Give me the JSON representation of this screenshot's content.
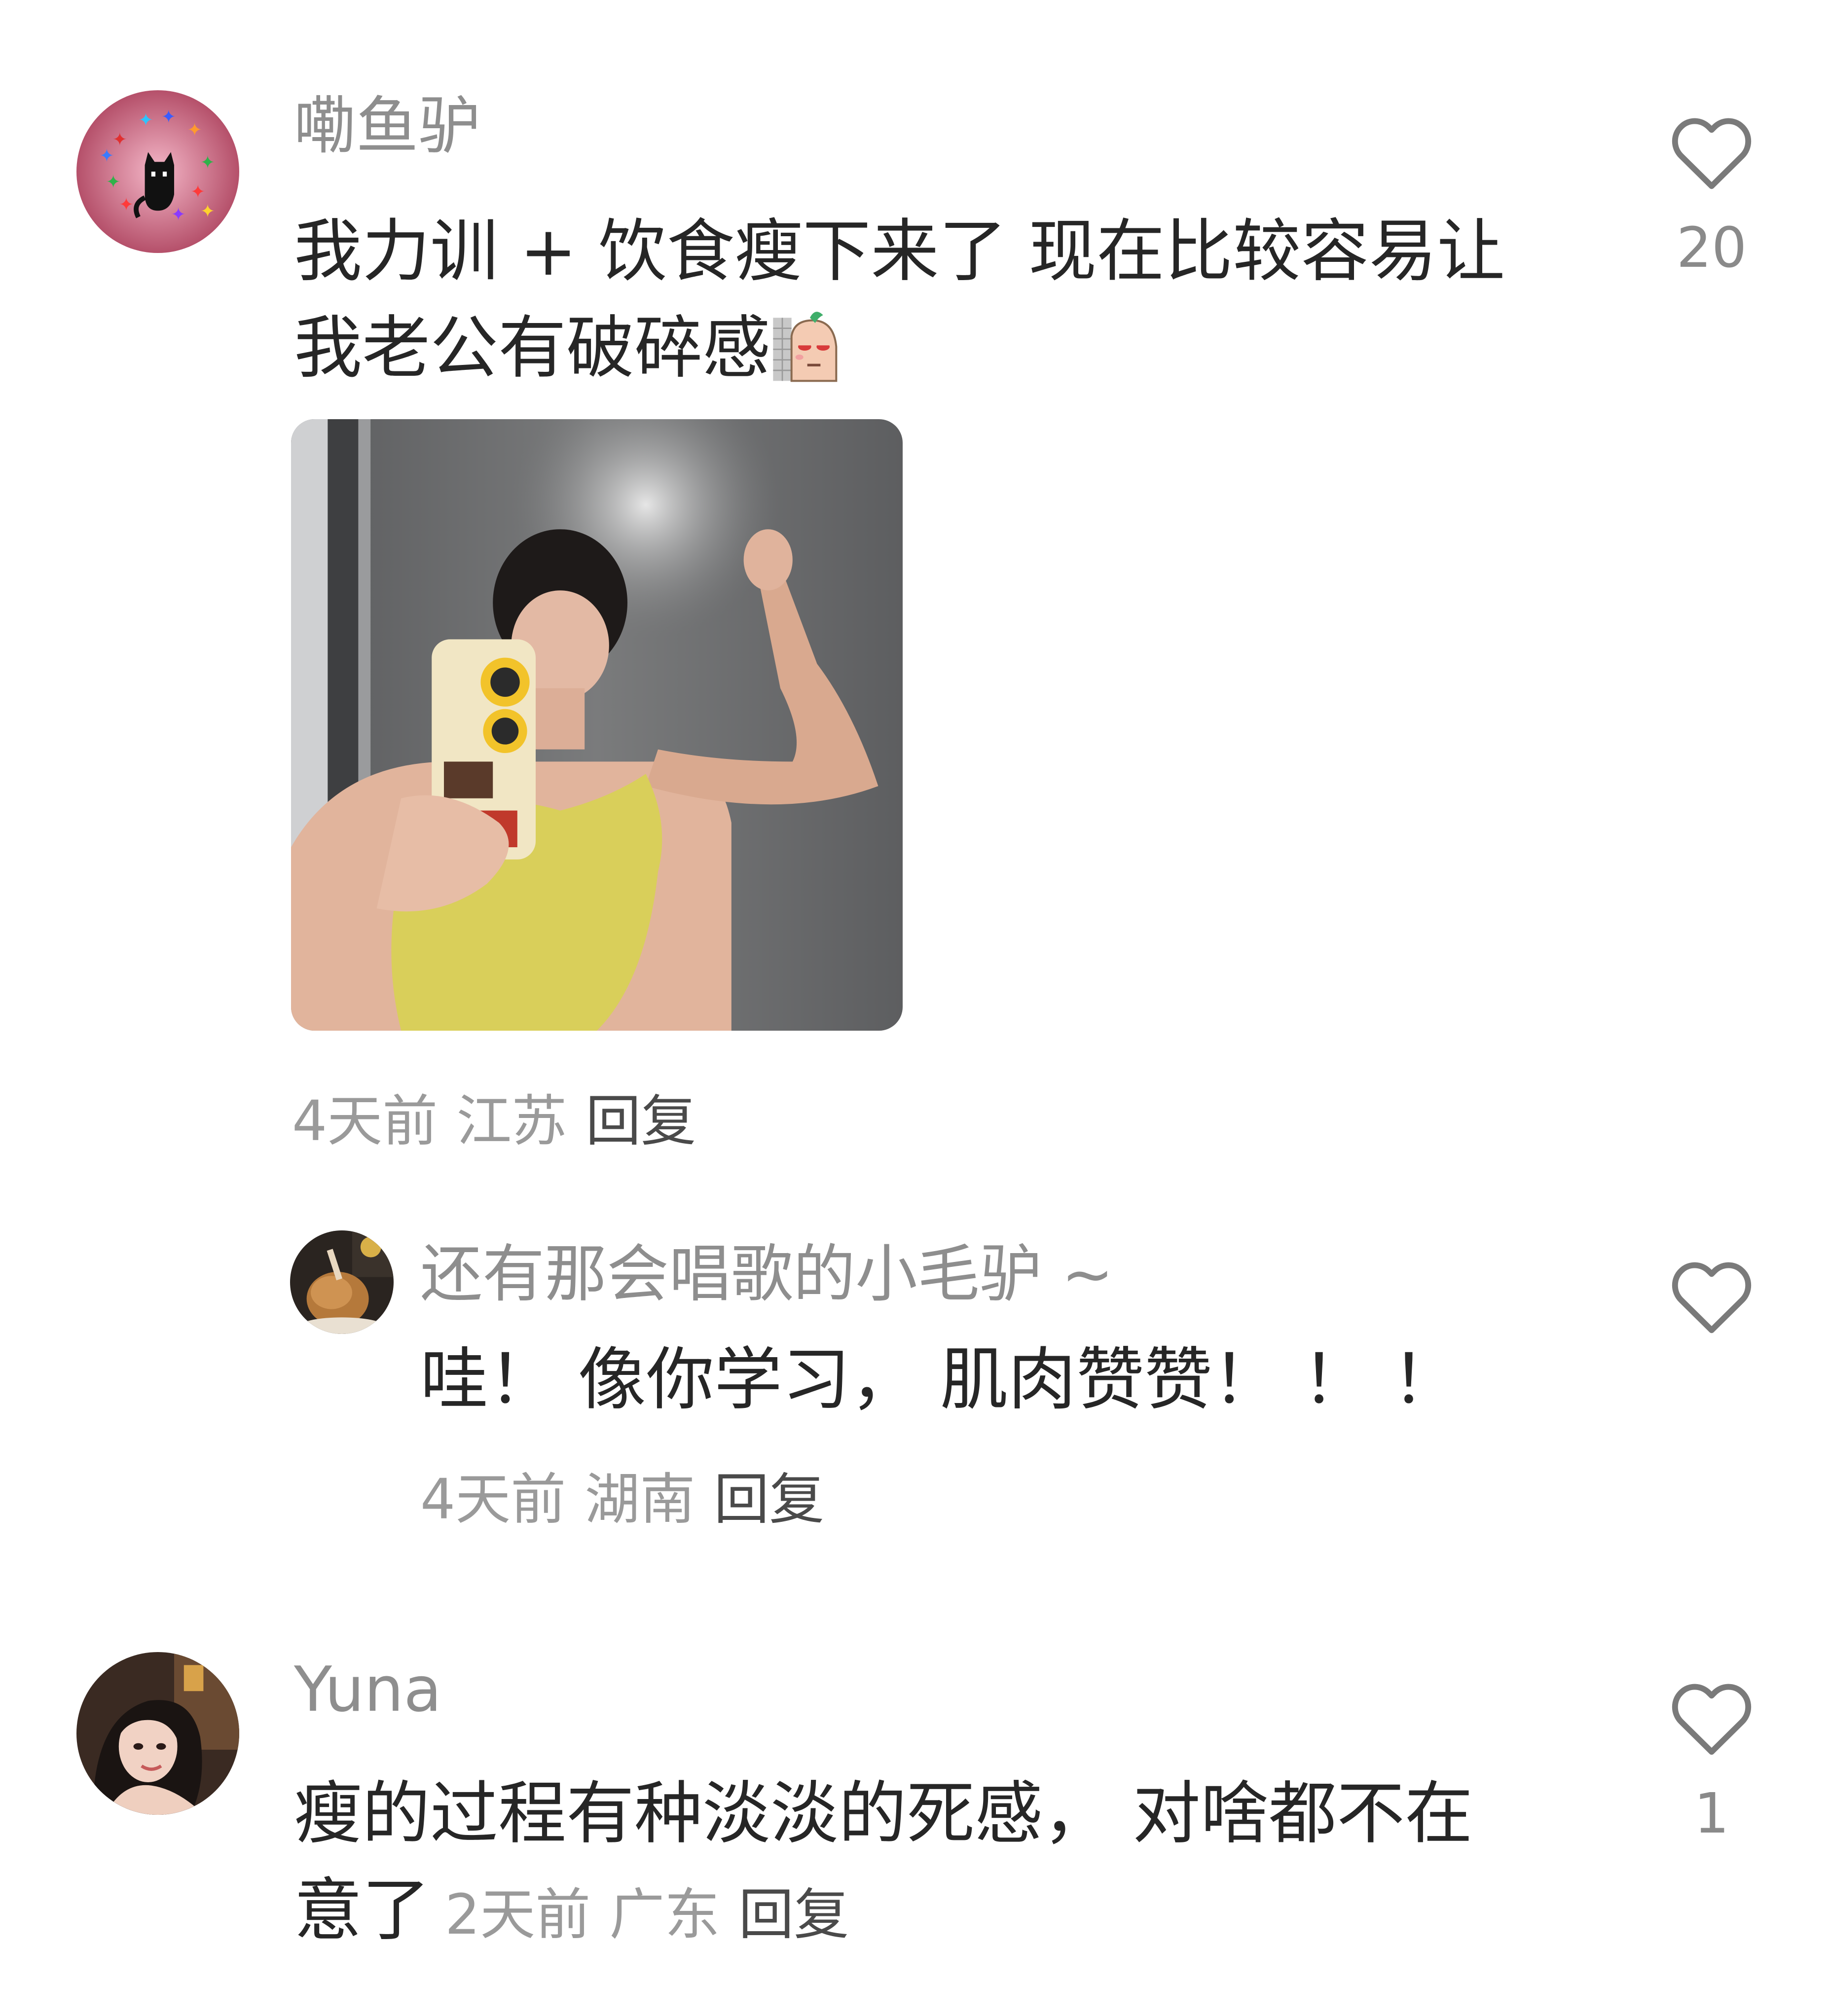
{
  "comments": [
    {
      "username": "嘞鱼驴",
      "text_line1": "我力训 + 饮食瘦下来了 现在比较容易让",
      "text_line2": "我老公有破碎感",
      "emoji": "sticker-emoji",
      "image": "mirror-selfie-photo",
      "time": "4天前",
      "location": "江苏",
      "reply_label": "回复",
      "likes": "20"
    },
    {
      "username": "还有那会唱歌的小毛驴 ~",
      "text": "哇！ 像你学习， 肌肉赞赞！ ！ ！",
      "time": "4天前",
      "location": "湖南",
      "reply_label": "回复"
    },
    {
      "username": "Yuna",
      "text_line1": "瘦的过程有种淡淡的死感， 对啥都不在",
      "text_line2": "意了",
      "time": "2天前",
      "location": "广东",
      "reply_label": "回复",
      "likes": "1"
    }
  ],
  "icons": {
    "like": "heart-outline-icon"
  },
  "colors": {
    "username": "#8e8e8e",
    "text": "#262626",
    "meta": "#9a9a9a"
  }
}
